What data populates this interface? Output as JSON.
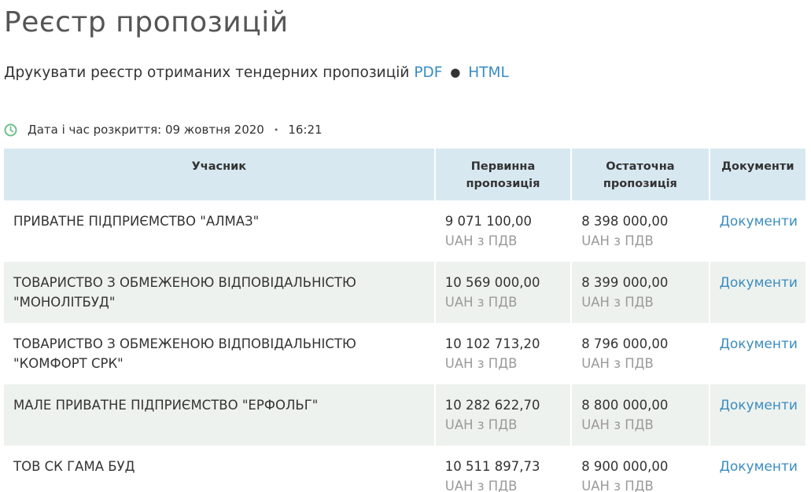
{
  "page": {
    "title": "Реєстр пропозицій",
    "print_text": "Друкувати реєстр отриманих тендерних пропозицій",
    "print_pdf": "PDF",
    "print_bullet": "●",
    "print_html": "HTML",
    "open_date_label": "Дата і час розкриття: 09 жовтня 2020",
    "open_date_sep": "•",
    "open_time": "16:21",
    "accent_color": "#3a8cc0",
    "clock_icon": "clock-icon"
  },
  "table": {
    "headers": {
      "participant": "Учасник",
      "initial_1": "Первинна",
      "initial_2": "пропозиція",
      "final_1": "Остаточна",
      "final_2": "пропозиція",
      "documents": "Документи"
    },
    "rows": [
      {
        "name_1": "ПРИВАТНЕ ПІДПРИЄМСТВО \"АЛМАЗ\"",
        "name_2": "",
        "initial": "9 071 100,00",
        "initial_vat": "UAH з ПДВ",
        "final": "8 398 000,00",
        "final_vat": "UAH з ПДВ",
        "docs": "Документи"
      },
      {
        "name_1": "ТОВАРИСТВО З ОБМЕЖЕНОЮ ВІДПОВІДАЛЬНІСТЮ",
        "name_2": "\"МОНОЛІТБУД\"",
        "initial": "10 569 000,00",
        "initial_vat": "UAH з ПДВ",
        "final": "8 399 000,00",
        "final_vat": "UAH з ПДВ",
        "docs": "Документи"
      },
      {
        "name_1": "ТОВАРИСТВО З ОБМЕЖЕНОЮ ВІДПОВІДАЛЬНІСТЮ",
        "name_2": "\"КОМФОРТ СРК\"",
        "initial": "10 102 713,20",
        "initial_vat": "UAH з ПДВ",
        "final": "8 796 000,00",
        "final_vat": "UAH з ПДВ",
        "docs": "Документи"
      },
      {
        "name_1": "МАЛЕ ПРИВАТНЕ ПІДПРИЄМСТВО \"ЕРФОЛЬГ\"",
        "name_2": "",
        "initial": "10 282 622,70",
        "initial_vat": "UAH з ПДВ",
        "final": "8 800 000,00",
        "final_vat": "UAH з ПДВ",
        "docs": "Документи"
      },
      {
        "name_1": "ТОВ СК ГАМА БУД",
        "name_2": "",
        "initial": "10 511 897,73",
        "initial_vat": "UAH з ПДВ",
        "final": "8 900 000,00",
        "final_vat": "UAH з ПДВ",
        "docs": "Документи"
      }
    ]
  }
}
